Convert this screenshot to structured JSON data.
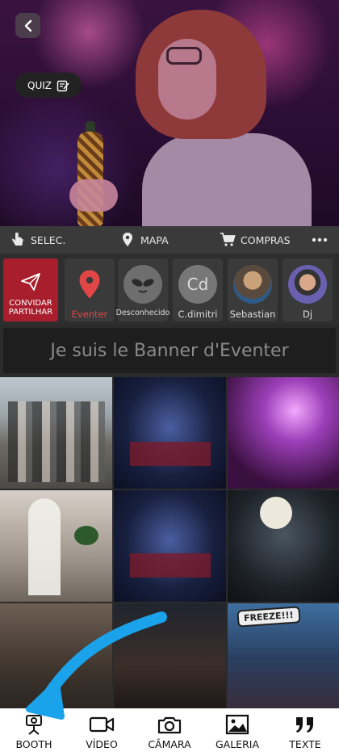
{
  "hero": {
    "back_icon": "chevron-left-icon",
    "quiz_label": "QUIZ",
    "quiz_icon": "edit-note-icon"
  },
  "actionbar": {
    "select_label": "SELEC.",
    "map_label": "MAPA",
    "shop_label": "COMPRAS",
    "more_icon": "more-horizontal-icon"
  },
  "stories": {
    "invite_line1": "CONVIDAR",
    "invite_line2": "PARTILHAR",
    "items": [
      {
        "label": "Eventer",
        "kind": "pin",
        "color": "#e04646"
      },
      {
        "label": "Desconhecido",
        "kind": "alien"
      },
      {
        "label": "C.dimitri",
        "kind": "initials",
        "initials": "Cd"
      },
      {
        "label": "Sebastian",
        "kind": "photo"
      },
      {
        "label": "Dj",
        "kind": "photo"
      }
    ]
  },
  "banner": {
    "text": "Je suis le Banner d'Eventer"
  },
  "gallery": {
    "freeze_text": "FREEZE!!!"
  },
  "bottomnav": {
    "items": [
      {
        "label": "BOOTH",
        "icon": "photo-booth-icon"
      },
      {
        "label": "VÍDEO",
        "icon": "video-camera-icon"
      },
      {
        "label": "CÂMARA",
        "icon": "camera-icon"
      },
      {
        "label": "GALERIA",
        "icon": "image-gallery-icon"
      },
      {
        "label": "TEXTE",
        "icon": "quote-icon"
      }
    ]
  },
  "colors": {
    "invite_bg": "#a81e2c",
    "eventer_pin": "#e04646",
    "arrow": "#1aa3ea"
  }
}
